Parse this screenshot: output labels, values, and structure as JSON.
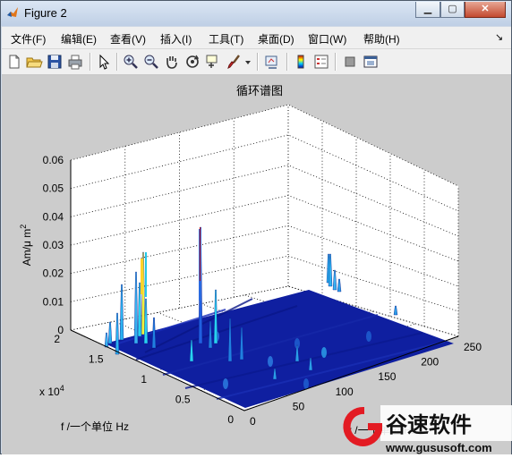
{
  "window": {
    "title": "Figure 2",
    "minimize": "▁",
    "maximize": "▢",
    "close": "✕",
    "chevron": "↘"
  },
  "menu": [
    "文件(F)",
    "编辑(E)",
    "查看(V)",
    "插入(I)",
    "工具(T)",
    "桌面(D)",
    "窗口(W)",
    "帮助(H)"
  ],
  "toolbar": {
    "icons": [
      "new-figure-icon",
      "open-file-icon",
      "save-icon",
      "print-icon",
      "select-arrow-icon",
      "zoom-in-icon",
      "zoom-out-icon",
      "pan-hand-icon",
      "rotate-3d-icon",
      "data-cursor-icon",
      "brush-icon",
      "brush-dropdown-icon",
      "link-plot-icon",
      "colorbar-icon",
      "legend-icon",
      "hide-plot-tools-icon",
      "show-plot-tools-icon"
    ]
  },
  "plot": {
    "title": "循环谱图",
    "zlabel": "Am/μ m",
    "zlabel_sup": "2",
    "ylabel": "f /一个单位 Hz",
    "xlabel": "α /一个单位 Hz",
    "y_exponent": "x 10",
    "y_exponent_sup": "4",
    "z_ticks": [
      "0",
      "0.01",
      "0.02",
      "0.03",
      "0.04",
      "0.05",
      "0.06"
    ],
    "y_ticks": [
      "0",
      "0.5",
      "1",
      "1.5",
      "2"
    ],
    "x_ticks": [
      "0",
      "50",
      "100",
      "150",
      "200",
      "250"
    ]
  },
  "watermark": {
    "name": "谷速软件",
    "url": "www.gususoft.com"
  }
}
